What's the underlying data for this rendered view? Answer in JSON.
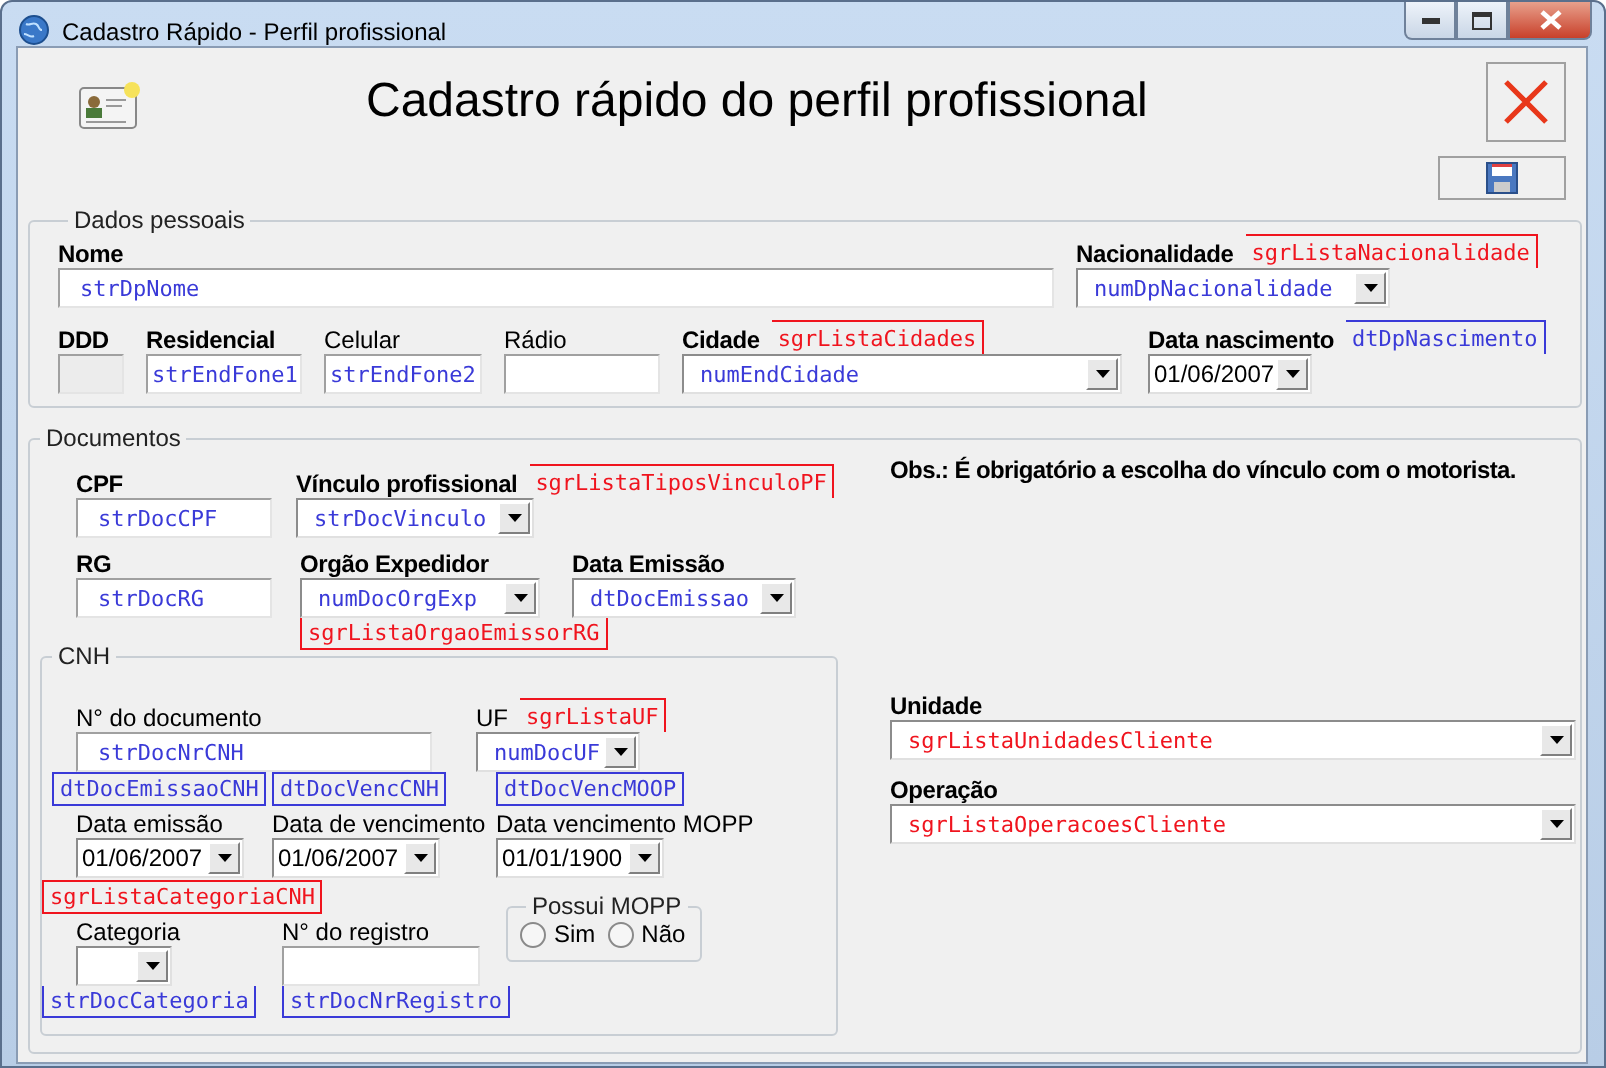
{
  "window": {
    "title": "Cadastro Rápido - Perfil profissional"
  },
  "header": {
    "title": "Cadastro rápido do perfil profissional"
  },
  "personal": {
    "legend": "Dados pessoais",
    "name": {
      "label": "Nome",
      "kind": "text",
      "value": "strDpNome",
      "color": "#3a3ad8"
    },
    "nationality": {
      "label": "Nacionalidade",
      "kind": "combo",
      "value": "numDpNacionalidade",
      "color": "#3a3ad8",
      "annotations": [
        {
          "text": "sgrListaNacionalidade",
          "color": "#f0141e",
          "kind": "beside"
        }
      ]
    },
    "phones": [
      {
        "label": "DDD",
        "bold": true,
        "disabled": true
      },
      {
        "label": "Residencial",
        "bold": true,
        "disabled": false,
        "value": "strEndFone1",
        "color": "#3a3ad8"
      },
      {
        "label": "Celular",
        "bold": false,
        "disabled": false,
        "value": "strEndFone2",
        "color": "#3a3ad8"
      },
      {
        "label": "Rádio",
        "bold": false,
        "disabled": false
      }
    ],
    "city": {
      "label": "Cidade",
      "kind": "combo",
      "value": "numEndCidade",
      "color": "#3a3ad8",
      "annotations": [
        {
          "text": "sgrListaCidades",
          "color": "#f0141e",
          "kind": "beside"
        }
      ]
    },
    "birth": {
      "label": "Data nascimento",
      "kind": "date",
      "value": "01/06/2007",
      "annotations": [
        {
          "text": "dtDpNascimento",
          "color": "#3a3ad8",
          "kind": "beside"
        }
      ]
    }
  },
  "documents": {
    "legend": "Documentos",
    "cpf": {
      "label": "CPF",
      "kind": "text",
      "value": "strDocCPF",
      "color": "#3a3ad8"
    },
    "bond": {
      "label": "Vínculo profissional",
      "kind": "combo",
      "value": "strDocVinculo",
      "color": "#3a3ad8",
      "annotations": [
        {
          "text": "sgrListaTiposVinculoPF",
          "color": "#f0141e",
          "kind": "beside"
        }
      ]
    },
    "note": "Obs.: É obrigatório a escolha do vínculo com o motorista.",
    "rg": {
      "label": "RG",
      "kind": "text",
      "value": "strDocRG",
      "color": "#3a3ad8"
    },
    "issuer": {
      "label": "Orgão Expedidor",
      "kind": "combo",
      "value": "numDocOrgExp",
      "color": "#3a3ad8",
      "annotations": [
        {
          "text": "sgrListaOrgaoEmissorRG",
          "color": "#f0141e",
          "kind": "below"
        }
      ]
    },
    "issue_date": {
      "label": "Data Emissão",
      "kind": "combo",
      "value": "dtDocEmissao",
      "color": "#3a3ad8"
    },
    "cnh": {
      "legend": "CNH",
      "number": {
        "label": "N° do documento",
        "kind": "text",
        "value": "strDocNrCNH",
        "color": "#3a3ad8"
      },
      "uf": {
        "label": "UF",
        "kind": "combo",
        "value": "numDocUF",
        "color": "#3a3ad8",
        "annotations": [
          {
            "text": "sgrListaUF",
            "color": "#f0141e",
            "kind": "beside"
          }
        ]
      },
      "dates": [
        {
          "label": "Data emissão",
          "kind": "date",
          "value": "01/06/2007",
          "annotations": [
            {
              "text": "dtDocEmissaoCNH",
              "color": "#3a3ad8",
              "kind": "above"
            }
          ]
        },
        {
          "label": "Data de vencimento",
          "kind": "date",
          "value": "01/06/2007",
          "annotations": [
            {
              "text": "dtDocVencCNH",
              "color": "#3a3ad8",
              "kind": "above"
            }
          ]
        },
        {
          "label": "Data vencimento MOPP",
          "kind": "date",
          "value": "01/01/1900",
          "annotations": [
            {
              "text": "dtDocVencMOOP",
              "color": "#3a3ad8",
              "kind": "above"
            }
          ]
        }
      ],
      "category": {
        "label": "Categoria",
        "kind": "combo",
        "annotations": [
          {
            "text": "sgrListaCategoriaCNH",
            "color": "#f0141e",
            "kind": "above"
          },
          {
            "text": "strDocCategoria",
            "color": "#3a3ad8",
            "kind": "below"
          }
        ]
      },
      "registry": {
        "label": "N° do registro",
        "kind": "text",
        "annotations": [
          {
            "text": "strDocNrRegistro",
            "color": "#3a3ad8",
            "kind": "below"
          }
        ]
      },
      "mopp": {
        "legend": "Possui MOPP",
        "options": [
          {
            "label": "Sim",
            "selected": false
          },
          {
            "label": "Não",
            "selected": false
          }
        ]
      }
    },
    "unit": {
      "label": "Unidade",
      "kind": "combo",
      "value": "sgrListaUnidadesCliente",
      "color": "#f0141e"
    },
    "operation": {
      "label": "Operação",
      "kind": "combo",
      "value": "sgrListaOperacoesCliente",
      "color": "#f0141e"
    }
  }
}
